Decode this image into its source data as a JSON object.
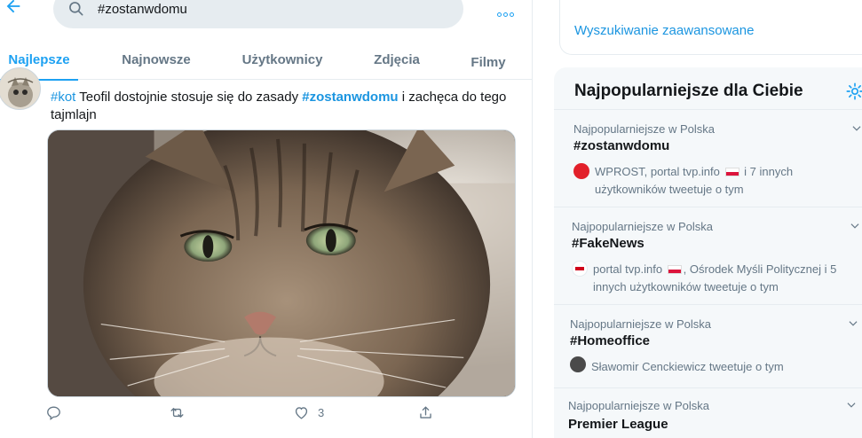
{
  "search": {
    "value": "#zostanwdomu"
  },
  "tabs": [
    {
      "label": "Najlepsze",
      "active": true
    },
    {
      "label": "Najnowsze",
      "active": false
    },
    {
      "label": "Użytkownicy",
      "active": false
    },
    {
      "label": "Zdjęcia",
      "active": false
    },
    {
      "label": "Filmy",
      "active": false
    }
  ],
  "tweet": {
    "hashtag_kot": "#kot",
    "text_part1": " Teofil dostojnie stosuje się do zasady ",
    "hashtag_zostan": "#zostanwdomu",
    "text_part2": " i zachęca do tego tajmlajn",
    "like_count": "3",
    "media_icon": "cat-photo"
  },
  "sidebar": {
    "advanced_search_label": "Wyszukiwanie zaawansowane",
    "trends_title": "Najpopularniejsze dla Ciebie",
    "trends": [
      {
        "meta": "Najpopularniejsze w Polska",
        "name": "#zostanwdomu",
        "desc_part1": "WPROST, portal tvp.info",
        "desc_part2": " i 7 innych użytkowników tweetuje o tym"
      },
      {
        "meta": "Najpopularniejsze w Polska",
        "name": "#FakeNews",
        "desc_part1": "portal tvp.info",
        "desc_part2": ", Ośrodek Myśli Politycznej i 5 innych użytkowników tweetuje o tym"
      },
      {
        "meta": "Najpopularniejsze w Polska",
        "name": "#Homeoffice",
        "desc_part1": "Sławomir Cenckiewicz tweetuje o tym"
      },
      {
        "meta": "Najpopularniejsze w Polska",
        "name": "Premier League"
      }
    ]
  },
  "colors": {
    "accent": "#1da1f2",
    "link": "#1b95e0",
    "muted": "#657786",
    "text": "#14171a"
  }
}
